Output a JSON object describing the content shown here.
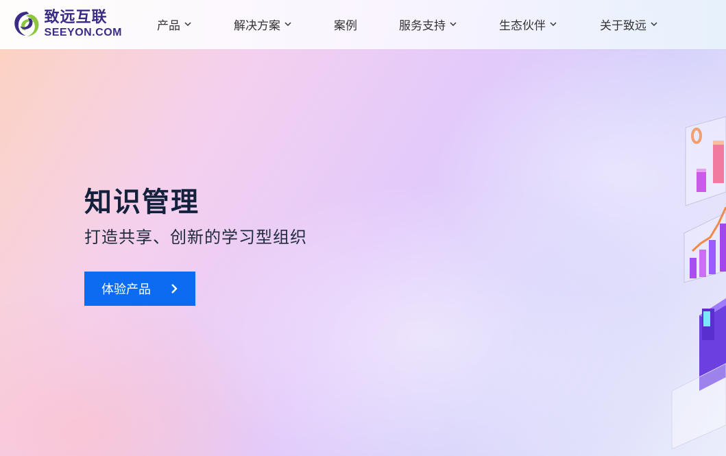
{
  "brand": {
    "name_cn": "致远互联",
    "name_en": "SEEYON.COM",
    "colors": {
      "purple": "#3a2b86",
      "green": "#8cc63f",
      "accent": "#0b6cf2"
    }
  },
  "nav": {
    "items": [
      {
        "label": "产品",
        "has_dropdown": true
      },
      {
        "label": "解决方案",
        "has_dropdown": true
      },
      {
        "label": "案例",
        "has_dropdown": false
      },
      {
        "label": "服务支持",
        "has_dropdown": true
      },
      {
        "label": "生态伙伴",
        "has_dropdown": true
      },
      {
        "label": "关于致远",
        "has_dropdown": true
      }
    ]
  },
  "hero": {
    "title": "知识管理",
    "subtitle": "打造共享、创新的学习型组织",
    "cta_label": "体验产品",
    "cta_icon": "chevron-right-icon"
  }
}
